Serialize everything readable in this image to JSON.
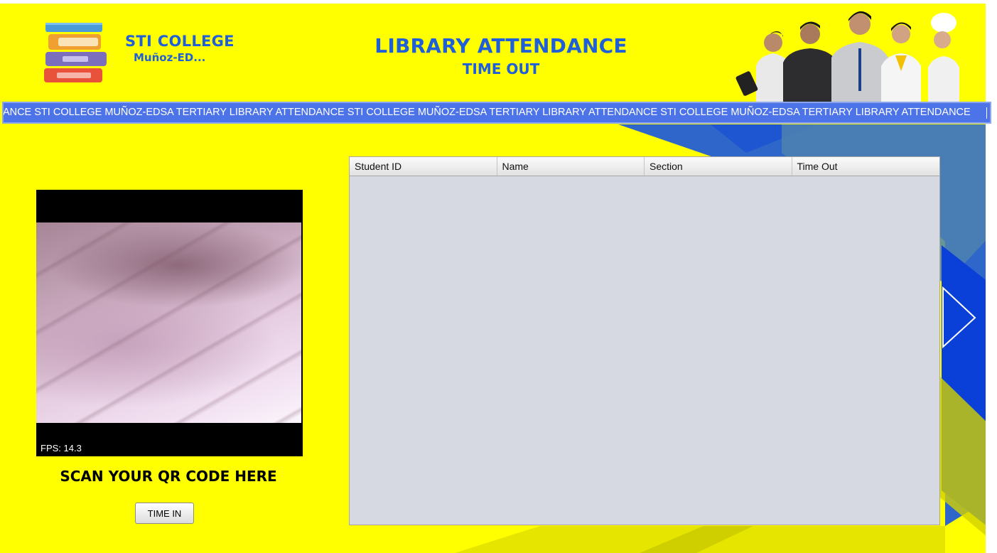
{
  "header": {
    "college_name": "STI COLLEGE",
    "college_branch": "Muñoz-ED...",
    "title": "LIBRARY ATTENDANCE",
    "subtitle": "TIME OUT"
  },
  "marquee": {
    "text": "NDANCE STI COLLEGE MUÑOZ-EDSA TERTIARY LIBRARY ATTENDANCE STI COLLEGE MUÑOZ-EDSA TERTIARY LIBRARY ATTENDANCE STI COLLEGE MUÑOZ-EDSA TERTIARY LIBRARY ATTENDANCE"
  },
  "camera": {
    "fps_text": "FPS: 14.3"
  },
  "scan": {
    "label": "SCAN YOUR QR CODE HERE",
    "button_label": "TIME IN"
  },
  "table": {
    "columns": [
      "Student ID",
      "Name",
      "Section",
      "Time Out"
    ],
    "rows": []
  },
  "colors": {
    "background": "#ffff00",
    "accent_blue": "#1f5fd9",
    "marquee_bg": "#4d73e8"
  },
  "icons": {
    "logo": "books-stack-icon",
    "banner_image": "students-group-image"
  }
}
